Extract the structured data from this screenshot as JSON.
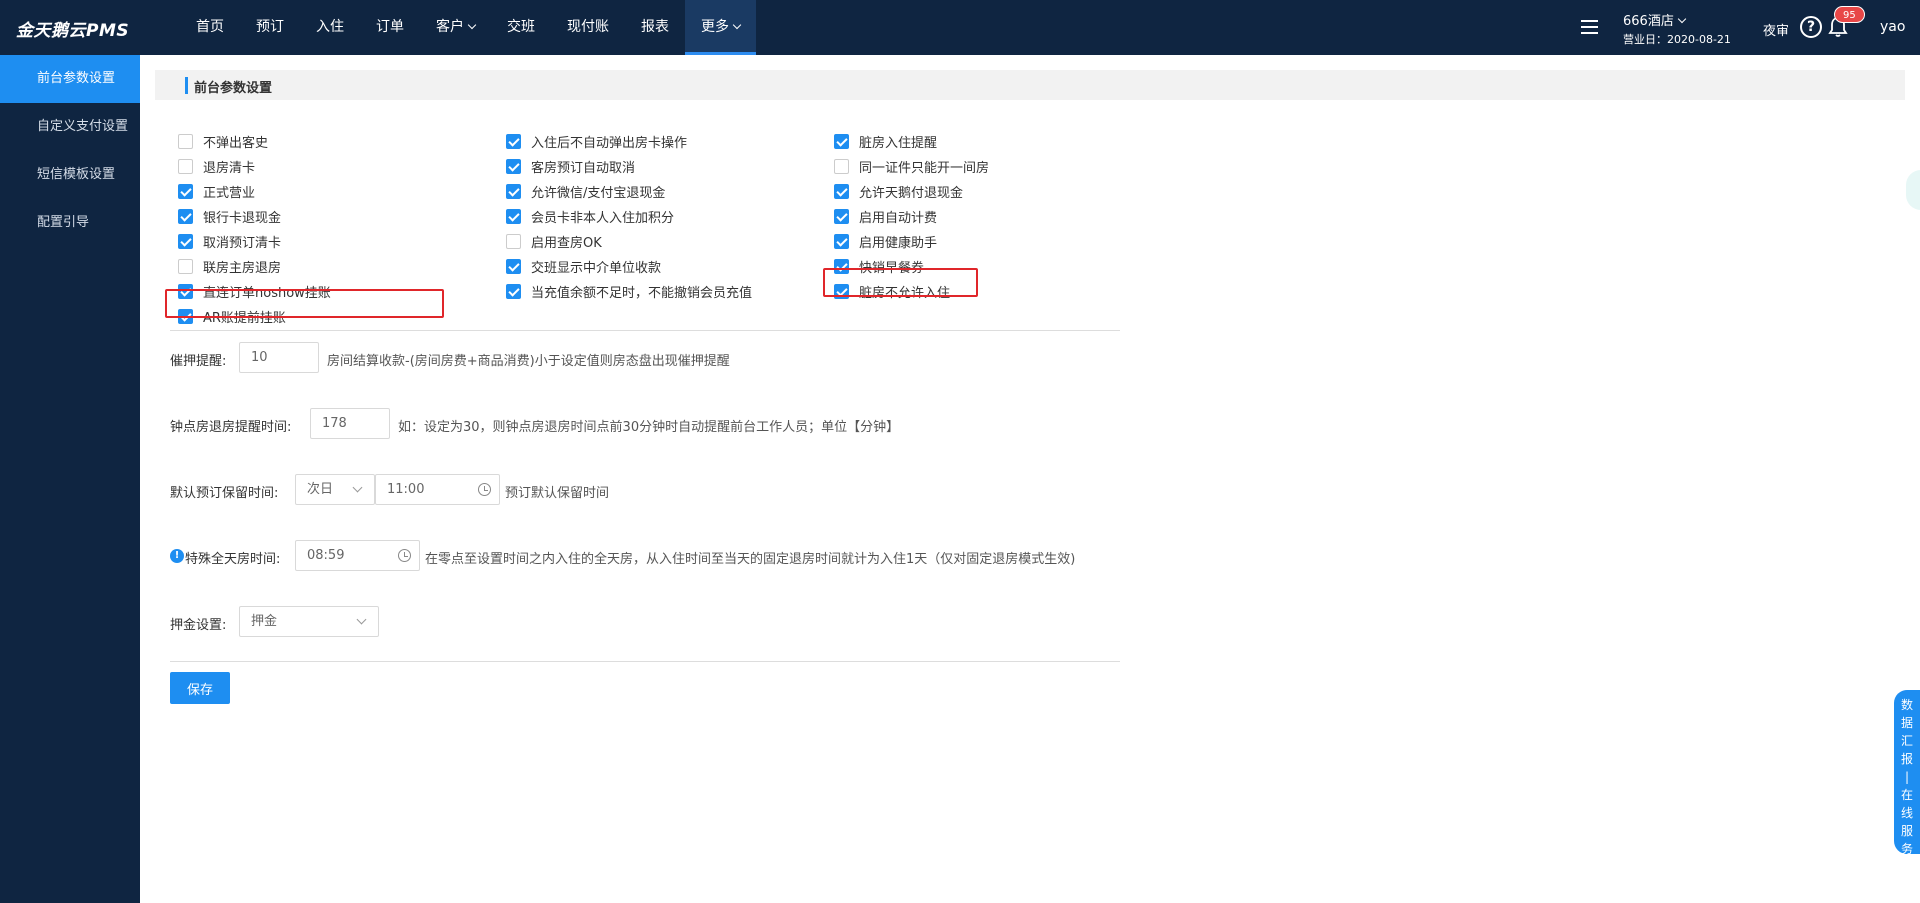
{
  "app": {
    "logo": "金天鹅云PMS"
  },
  "nav": {
    "items": [
      {
        "label": "首页",
        "caret": false,
        "active": false
      },
      {
        "label": "预订",
        "caret": false,
        "active": false
      },
      {
        "label": "入住",
        "caret": false,
        "active": false
      },
      {
        "label": "订单",
        "caret": false,
        "active": false
      },
      {
        "label": "客户",
        "caret": true,
        "active": false
      },
      {
        "label": "交班",
        "caret": false,
        "active": false
      },
      {
        "label": "现付账",
        "caret": false,
        "active": false
      },
      {
        "label": "报表",
        "caret": false,
        "active": false
      },
      {
        "label": "更多",
        "caret": true,
        "active": true
      }
    ]
  },
  "header": {
    "hotel": "666酒店",
    "business_date": "营业日：2020-08-21",
    "night_audit": "夜审",
    "help": "?",
    "notification_count": "95",
    "user": "yao"
  },
  "sidebar": {
    "items": [
      {
        "label": "前台参数设置",
        "active": true
      },
      {
        "label": "自定义支付设置",
        "active": false
      },
      {
        "label": "短信模板设置",
        "active": false
      },
      {
        "label": "配置引导",
        "active": false
      }
    ]
  },
  "section": {
    "title": "前台参数设置"
  },
  "checkboxes": {
    "col1": [
      {
        "label": "不弹出客史",
        "checked": false
      },
      {
        "label": "退房清卡",
        "checked": false
      },
      {
        "label": "正式营业",
        "checked": true
      },
      {
        "label": "银行卡退现金",
        "checked": true
      },
      {
        "label": "取消预订清卡",
        "checked": true
      },
      {
        "label": "联房主房退房",
        "checked": false
      },
      {
        "label": "直连订单noshow挂账",
        "checked": true
      },
      {
        "label": "AR账提前挂账",
        "checked": true
      }
    ],
    "col2": [
      {
        "label": "入住后不自动弹出房卡操作",
        "checked": true
      },
      {
        "label": "客房预订自动取消",
        "checked": true
      },
      {
        "label": "允许微信/支付宝退现金",
        "checked": true
      },
      {
        "label": "会员卡非本人入住加积分",
        "checked": true
      },
      {
        "label": "启用查房OK",
        "checked": false
      },
      {
        "label": "交班显示中介单位收款",
        "checked": true
      },
      {
        "label": "当充值余额不足时，不能撤销会员充值",
        "checked": true
      }
    ],
    "col3": [
      {
        "label": "脏房入住提醒",
        "checked": true
      },
      {
        "label": "同一证件只能开一间房",
        "checked": false
      },
      {
        "label": "允许天鹅付退现金",
        "checked": true
      },
      {
        "label": "启用自动计费",
        "checked": true
      },
      {
        "label": "启用健康助手",
        "checked": true
      },
      {
        "label": "快销早餐券",
        "checked": true
      },
      {
        "label": "脏房不允许入住",
        "checked": true
      }
    ]
  },
  "fields": {
    "deposit_reminder": {
      "label": "催押提醒:",
      "value": "10",
      "hint": "房间结算收款-(房间房费+商品消费)小于设定值则房态盘出现催押提醒"
    },
    "hourly_checkout": {
      "label": "钟点房退房提醒时间:",
      "value": "178",
      "hint": "如：设定为30，则钟点房退房时间点前30分钟时自动提醒前台工作人员；单位【分钟】"
    },
    "reservation_hold": {
      "label": "默认预订保留时间:",
      "day_value": "次日",
      "time_value": "11:00",
      "hint": "预订默认保留时间"
    },
    "special_fullday": {
      "label": "特殊全天房时间:",
      "value": "08:59",
      "hint": "在零点至设置时间之内入住的全天房，从入住时间至当天的固定退房时间就计为入住1天（仅对固定退房模式生效)"
    },
    "deposit_setting": {
      "label": "押金设置:",
      "value": "押金"
    }
  },
  "actions": {
    "save": "保存"
  },
  "float_panel": {
    "chars": [
      "数",
      "据",
      "汇",
      "报",
      "|",
      "在",
      "线",
      "服",
      "务"
    ]
  }
}
